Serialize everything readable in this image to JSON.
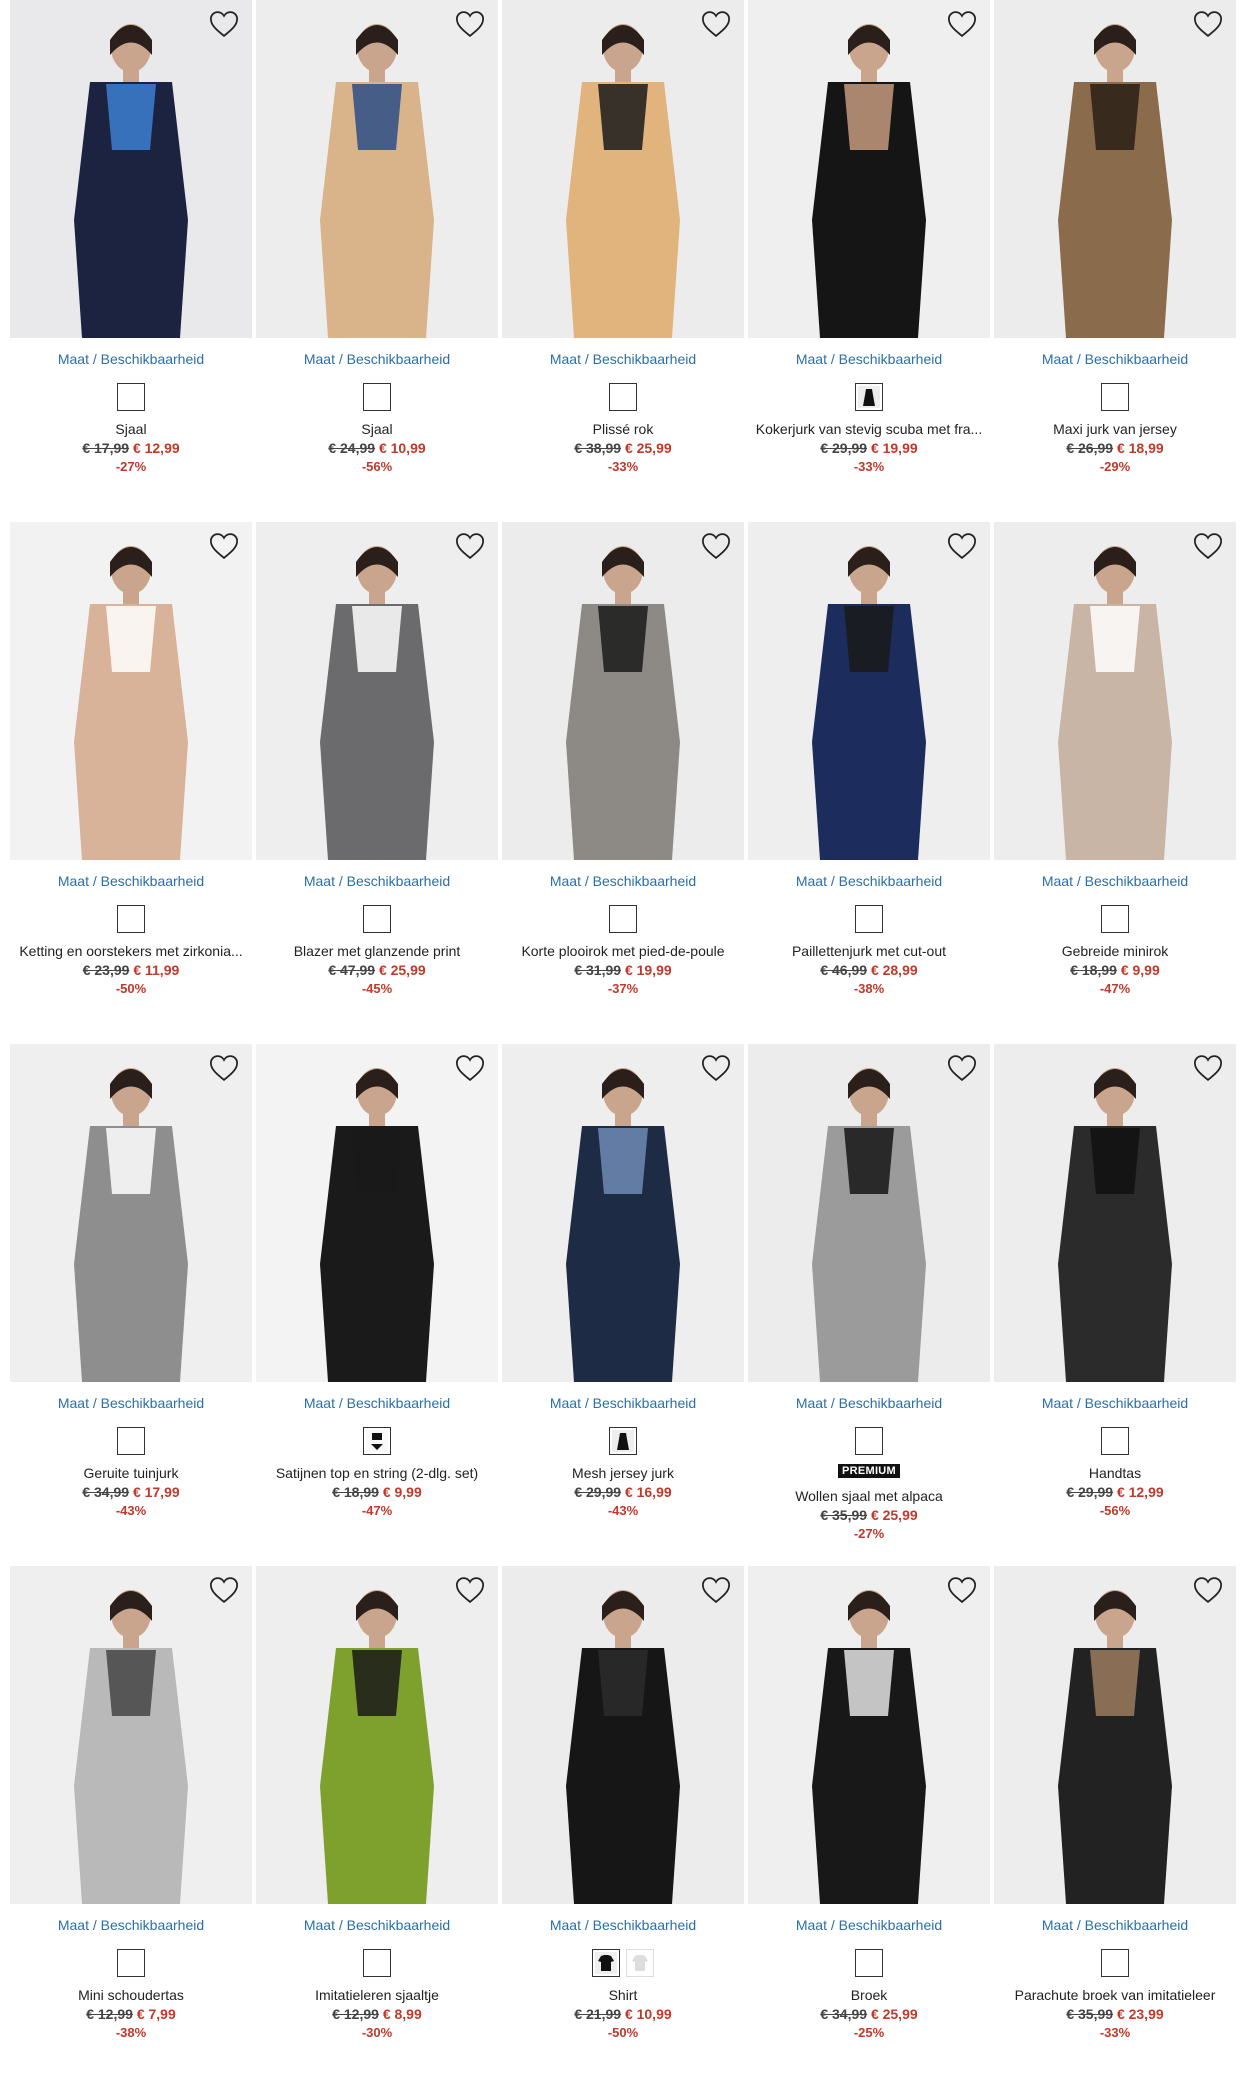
{
  "availability_label": "Maat / Beschikbaarheid",
  "colors": {
    "link": "#2a6fa8",
    "sale": "#c0392b"
  },
  "products": [
    {
      "name": "Sjaal",
      "old_price": "€ 17,99",
      "new_price": "€ 12,99",
      "discount": "-27%",
      "swatch": "blank",
      "bg": "#e9e9ec",
      "fig": "#1b2340",
      "acc": "#3c7fd1"
    },
    {
      "name": "Sjaal",
      "old_price": "€ 24,99",
      "new_price": "€ 10,99",
      "discount": "-56%",
      "swatch": "blank",
      "bg": "#ededed",
      "fig": "#d9b48a",
      "acc": "#2b4d86"
    },
    {
      "name": "Plissé rok",
      "old_price": "€ 38,99",
      "new_price": "€ 25,99",
      "discount": "-33%",
      "swatch": "blank",
      "bg": "#ececec",
      "fig": "#e2b47d",
      "acc": "#1a1a1a"
    },
    {
      "name": "Kokerjurk van stevig scuba met fra...",
      "old_price": "€ 29,99",
      "new_price": "€ 19,99",
      "discount": "-33%",
      "swatch": "dress",
      "bg": "#efefef",
      "fig": "#151515",
      "acc": "#c49a7e"
    },
    {
      "name": "Maxi jurk van jersey",
      "old_price": "€ 26,99",
      "new_price": "€ 18,99",
      "discount": "-29%",
      "swatch": "blank",
      "bg": "#ececec",
      "fig": "#8a6b4c",
      "acc": "#2a1e16"
    },
    {
      "name": "Ketting en oorstekers met zirkonia...",
      "old_price": "€ 23,99",
      "new_price": "€ 11,99",
      "discount": "-50%",
      "swatch": "blank",
      "bg": "#f2f2f2",
      "fig": "#d8b299",
      "acc": "#ffffff"
    },
    {
      "name": "Blazer met glanzende print",
      "old_price": "€ 47,99",
      "new_price": "€ 25,99",
      "discount": "-45%",
      "swatch": "blank",
      "bg": "#eeeeee",
      "fig": "#6b6b6d",
      "acc": "#ffffff"
    },
    {
      "name": "Korte plooirok met pied-de-poule",
      "old_price": "€ 31,99",
      "new_price": "€ 19,99",
      "discount": "-37%",
      "swatch": "blank",
      "bg": "#ececec",
      "fig": "#8d8a85",
      "acc": "#1a1a1a"
    },
    {
      "name": "Paillettenjurk met cut-out",
      "old_price": "€ 46,99",
      "new_price": "€ 28,99",
      "discount": "-38%",
      "swatch": "blank",
      "bg": "#eeeeee",
      "fig": "#1c2c5c",
      "acc": "#1a1a1a"
    },
    {
      "name": "Gebreide minirok",
      "old_price": "€ 18,99",
      "new_price": "€ 9,99",
      "discount": "-47%",
      "swatch": "blank",
      "bg": "#ededed",
      "fig": "#c9b5a6",
      "acc": "#ffffff"
    },
    {
      "name": "Geruite tuinjurk",
      "old_price": "€ 34,99",
      "new_price": "€ 17,99",
      "discount": "-43%",
      "swatch": "blank",
      "bg": "#efefef",
      "fig": "#8e8e8e",
      "acc": "#ffffff"
    },
    {
      "name": "Satijnen top en string (2-dlg. set)",
      "old_price": "€ 18,99",
      "new_price": "€ 9,99",
      "discount": "-47%",
      "swatch": "set",
      "bg": "#f3f3f3",
      "fig": "#1a1a1a",
      "acc": "#1a1a1a"
    },
    {
      "name": "Mesh jersey jurk",
      "old_price": "€ 29,99",
      "new_price": "€ 16,99",
      "discount": "-43%",
      "swatch": "dress",
      "bg": "#eeeeee",
      "fig": "#1e2b45",
      "acc": "#6e8bb5"
    },
    {
      "name": "Wollen sjaal met alpaca",
      "old_price": "€ 35,99",
      "new_price": "€ 25,99",
      "discount": "-27%",
      "swatch": "blank",
      "premium": "PREMIUM",
      "bg": "#ececec",
      "fig": "#9b9b9b",
      "acc": "#151515"
    },
    {
      "name": "Handtas",
      "old_price": "€ 29,99",
      "new_price": "€ 12,99",
      "discount": "-56%",
      "swatch": "blank",
      "bg": "#ededed",
      "fig": "#2b2b2b",
      "acc": "#111111"
    },
    {
      "name": "Mini schoudertas",
      "old_price": "€ 12,99",
      "new_price": "€ 7,99",
      "discount": "-38%",
      "swatch": "blank",
      "bg": "#efefef",
      "fig": "#b9b9b9",
      "acc": "#444444"
    },
    {
      "name": "Imitatieleren sjaaltje",
      "old_price": "€ 12,99",
      "new_price": "€ 8,99",
      "discount": "-30%",
      "swatch": "blank",
      "bg": "#eeeeee",
      "fig": "#7da12c",
      "acc": "#1a1a1a"
    },
    {
      "name": "Shirt",
      "old_price": "€ 21,99",
      "new_price": "€ 10,99",
      "discount": "-50%",
      "swatch": "shirt",
      "bg": "#ececec",
      "fig": "#161616",
      "acc": "#2b2b2b"
    },
    {
      "name": "Broek",
      "old_price": "€ 34,99",
      "new_price": "€ 25,99",
      "discount": "-25%",
      "swatch": "blank",
      "bg": "#efefef",
      "fig": "#181818",
      "acc": "#e3e3e3"
    },
    {
      "name": "Parachute broek van imitatieleer",
      "old_price": "€ 35,99",
      "new_price": "€ 23,99",
      "discount": "-33%",
      "swatch": "blank",
      "bg": "#ededed",
      "fig": "#222222",
      "acc": "#9b7a5e"
    }
  ]
}
